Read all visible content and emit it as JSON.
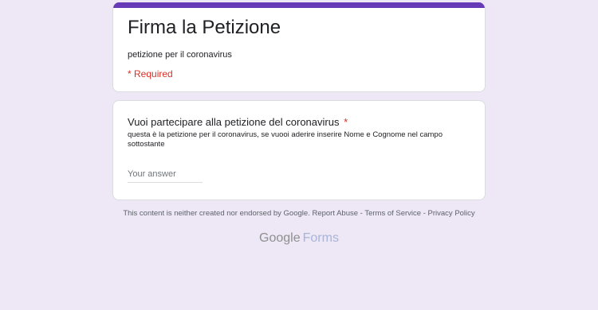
{
  "colors": {
    "accent": "#673ab7",
    "background": "#ede7f6",
    "required": "#d93025"
  },
  "header": {
    "title": "Firma la Petizione",
    "description": "petizione per il coronavirus",
    "required_note": "* Required"
  },
  "question": {
    "title": "Vuoi partecipare alla petizione del coronavirus",
    "required_marker": "*",
    "help_text": "questa è la petizione per il coronavirus, se vuooi aderire inserire Nome e Cognome nel campo sottostante",
    "answer_placeholder": "Your answer",
    "answer_value": ""
  },
  "footer": {
    "disclaimer": "This content is neither created nor endorsed by Google.",
    "links": [
      "Report Abuse",
      "Terms of Service",
      "Privacy Policy"
    ],
    "separator": " - "
  },
  "brand": {
    "google": "Google",
    "forms": "Forms"
  }
}
